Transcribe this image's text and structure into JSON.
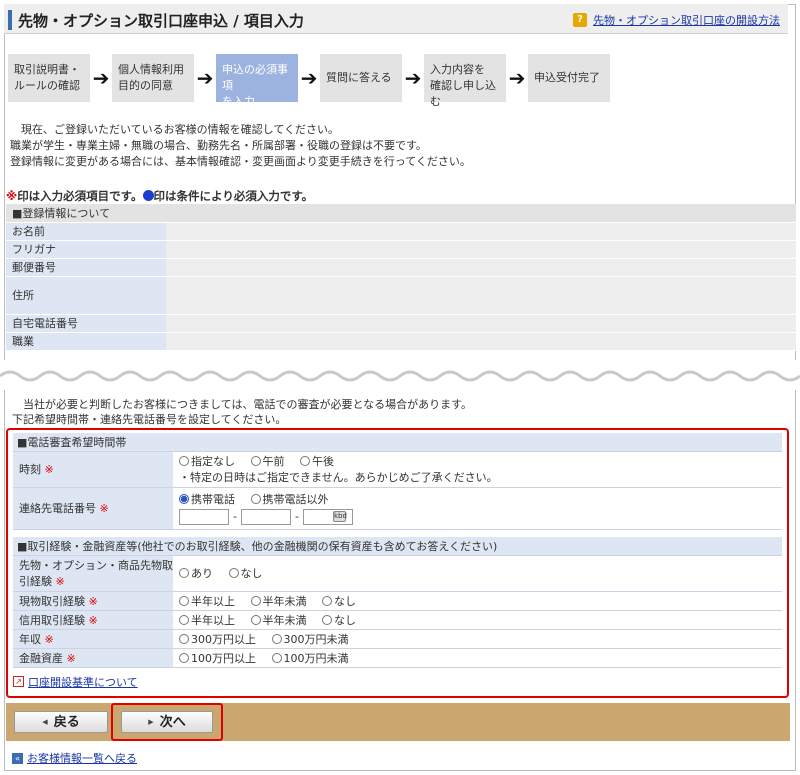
{
  "header": {
    "title": "先物・オプション取引口座申込 / 項目入力",
    "help_icon": "?",
    "help_link": "先物・オプション取引口座の開設方法"
  },
  "steps": [
    {
      "label": "取引説明書・\nルールの確認",
      "active": false
    },
    {
      "label": "個人情報利用\n目的の同意",
      "active": false
    },
    {
      "label": "申込の必須事項\nを入力",
      "active": true
    },
    {
      "label": "質問に答える",
      "active": false
    },
    {
      "label": "入力内容を\n確認し申し込む",
      "active": false
    },
    {
      "label": "申込受付完了",
      "active": false
    }
  ],
  "step_arrow": "➔",
  "intro": [
    "現在、ご登録いただいているお客様の情報を確認してください。",
    "職業が学生・専業主婦・無職の場合、勤務先名・所属部署・役職の登録は不要です。",
    "登録情報に変更がある場合には、基本情報確認・変更画面より変更手続きを行ってください。"
  ],
  "required_note": {
    "mark": "※",
    "text1": "印は入力必須項目です。",
    "text2": "印は条件により必須入力です。"
  },
  "registration": {
    "section": "■登録情報について",
    "rows": [
      "お名前",
      "フリガナ",
      "郵便番号",
      "住所",
      "自宅電話番号",
      "職業"
    ]
  },
  "notice": [
    "当社が必要と判断したお客様につきましては、電話での審査が必要となる場合があります。",
    "下記希望時間帯・連絡先電話番号を設定してください。"
  ],
  "phone_section": {
    "title": "■電話審査希望時間帯",
    "time_label": "時刻",
    "time_options": [
      "指定なし",
      "午前",
      "午後"
    ],
    "time_note": "・特定の日時はご指定できません。あらかじめご了承ください。",
    "tel_label": "連絡先電話番号",
    "tel_options": [
      "携帯電話",
      "携帯電話以外"
    ],
    "tel_selected": 0,
    "dash": "-",
    "keyboard_icon": "kbd"
  },
  "experience_section": {
    "title": "■取引経験・金融資産等(他社でのお取引経験、他の金融機関の保有資産も含めてお答えください)",
    "rows": [
      {
        "label": "先物・オプション・商品先物取引経験",
        "options": [
          "あり",
          "なし"
        ]
      },
      {
        "label": "現物取引経験",
        "options": [
          "半年以上",
          "半年未満",
          "なし"
        ]
      },
      {
        "label": "信用取引経験",
        "options": [
          "半年以上",
          "半年未満",
          "なし"
        ]
      },
      {
        "label": "年収",
        "options": [
          "300万円以上",
          "300万円未満"
        ]
      },
      {
        "label": "金融資産",
        "options": [
          "100万円以上",
          "100万円未満"
        ]
      }
    ],
    "standard_link": "口座開設基準について"
  },
  "required_mark": "※",
  "buttons": {
    "back": "戻る",
    "next": "次へ"
  },
  "back_to_list": "お客様情報一覧へ戻る",
  "colors": {
    "accent": "#3a6db4",
    "required": "#e00000",
    "active_step": "#9db3df",
    "button_bar": "#c9a76f"
  }
}
